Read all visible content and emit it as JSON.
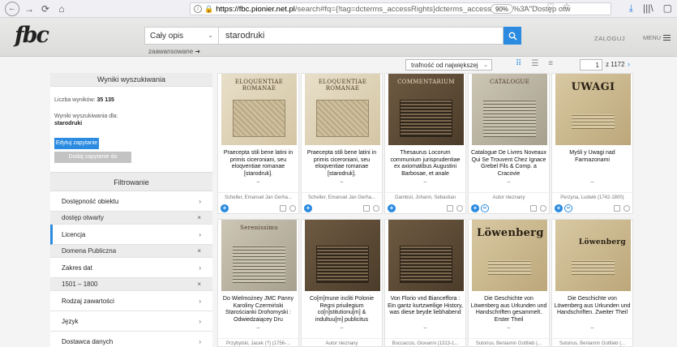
{
  "browser": {
    "back": "←",
    "forward": "→",
    "reload": "⟳",
    "home": "⌂",
    "url_info": "i",
    "url_host": "https://fbc.pionier.net.pl",
    "url_rest": "/search#fq={!tag=dcterms_accessRights}dcterms_accessRights%3A\"Dostęp otw",
    "zoom": "90%",
    "url_actions": "··· ♡ ☆",
    "download": "⤓",
    "library": "|||\\",
    "sidebar_toggle": "▢"
  },
  "header": {
    "logo": "fbc",
    "scope": "Cały opis",
    "scope_chevron": "⌄",
    "advanced": "zaawansowane",
    "advanced_icon": "➜",
    "query": "starodruki",
    "login": "ZALOGUJ",
    "menu": "MENU"
  },
  "toolbar": {
    "sort": "trafność od największej",
    "sort_chevron": "⌄",
    "view_grid": "⠿",
    "view_list": "☰",
    "view_compact": "≡",
    "page": "1",
    "page_total": "z 1172",
    "next": "›"
  },
  "sidebar": {
    "results_title": "Wyniki wyszukiwania",
    "count_label": "Liczba wyników:",
    "count": "35 135",
    "for_label": "Wyniki wyszukiwania dla:",
    "for_query": "starodruki",
    "edit_btn": "Edytuj zapytanie",
    "fav_btn": "Dodaj zapytanie do ulubionych",
    "filter_title": "Filtrowanie",
    "arrow": "›",
    "remove": "×",
    "filters": [
      {
        "label": "Dostępność obiektu",
        "selected": "dostęp otwarty"
      },
      {
        "label": "Licencja",
        "selected": "Domena Publiczna"
      },
      {
        "label": "Zakres dat",
        "selected": "1501 – 1800"
      },
      {
        "label": "Rodzaj zawartości"
      },
      {
        "label": "Język"
      },
      {
        "label": "Dostawca danych"
      }
    ]
  },
  "results": [
    {
      "thumb": "ELOQUENTIAE ROMANAE",
      "title": "Praecepta stili bene latini in primis ciceroniani, seu eloqventiae romanae [starodruk].",
      "author": "Scheller, Emanuel Jan Gerha..."
    },
    {
      "thumb": "ELOQUENTIAE ROMANAE",
      "title": "Praecepta stili bene latini in primis ciceroniani, seu eloqventiae romanae [starodruk].",
      "author": "Scheller, Emanuel Jan Gerha..."
    },
    {
      "thumb": "COMMENTARIUM",
      "title": "Thesaurus Locorum communium jurisprudentiae ex axiomatibus Augustini Barbosae, et anale",
      "author": "Gambsii, Johann, Sebastian"
    },
    {
      "thumb": "CATALOGUE",
      "title": "Catalogue De Livres Noveaux Qui Se Trouvent Chez Ignace Grebel Fils & Comp. a Cracovie",
      "author": "Autor nieznany"
    },
    {
      "thumb": "UWAGI",
      "title": "Myśli y Uwagi nad Farmazonami",
      "author": "Perzyna, Ludwik (1742-1800)"
    },
    {
      "thumb": "Serenissimo",
      "title": "Do Wielmożney JMC Panny Karoliny Czermiński Starościanki Drohomyski : Odwiedzaiącey Dru",
      "author": "Przybylski, Jacek (?) (1756-..."
    },
    {
      "thumb": "",
      "title": "Co[m]mune incliti Polonie Regni priuilegium co[n]stitutionu[m] & indultuu[m] publicitus",
      "author": "Autor nieznany"
    },
    {
      "thumb": "",
      "title": "Von Florio vnd Bianceffora : Ein gantz kurtzweilige History, was diese beyde liebhabend",
      "author": "Boccaccio, Giovanni (1313-1..."
    },
    {
      "thumb": "Löwenberg",
      "title": "Die Geschichte von Löwenberg aus Urkunden und Handschriften gesammelt. Erster Theil",
      "author": "Sutorius, Beniamin Gottlieb (..."
    },
    {
      "thumb": "Löwenberg",
      "title": "Die Geschichte von Löwenberg aus Urkunden und Handschriften. Zweiter Theil",
      "author": "Sutorius, Beniamin Gottlieb (..."
    }
  ],
  "card_dash": "–",
  "icons": {
    "plus": "+",
    "link": "∞",
    "search": "search-icon"
  }
}
